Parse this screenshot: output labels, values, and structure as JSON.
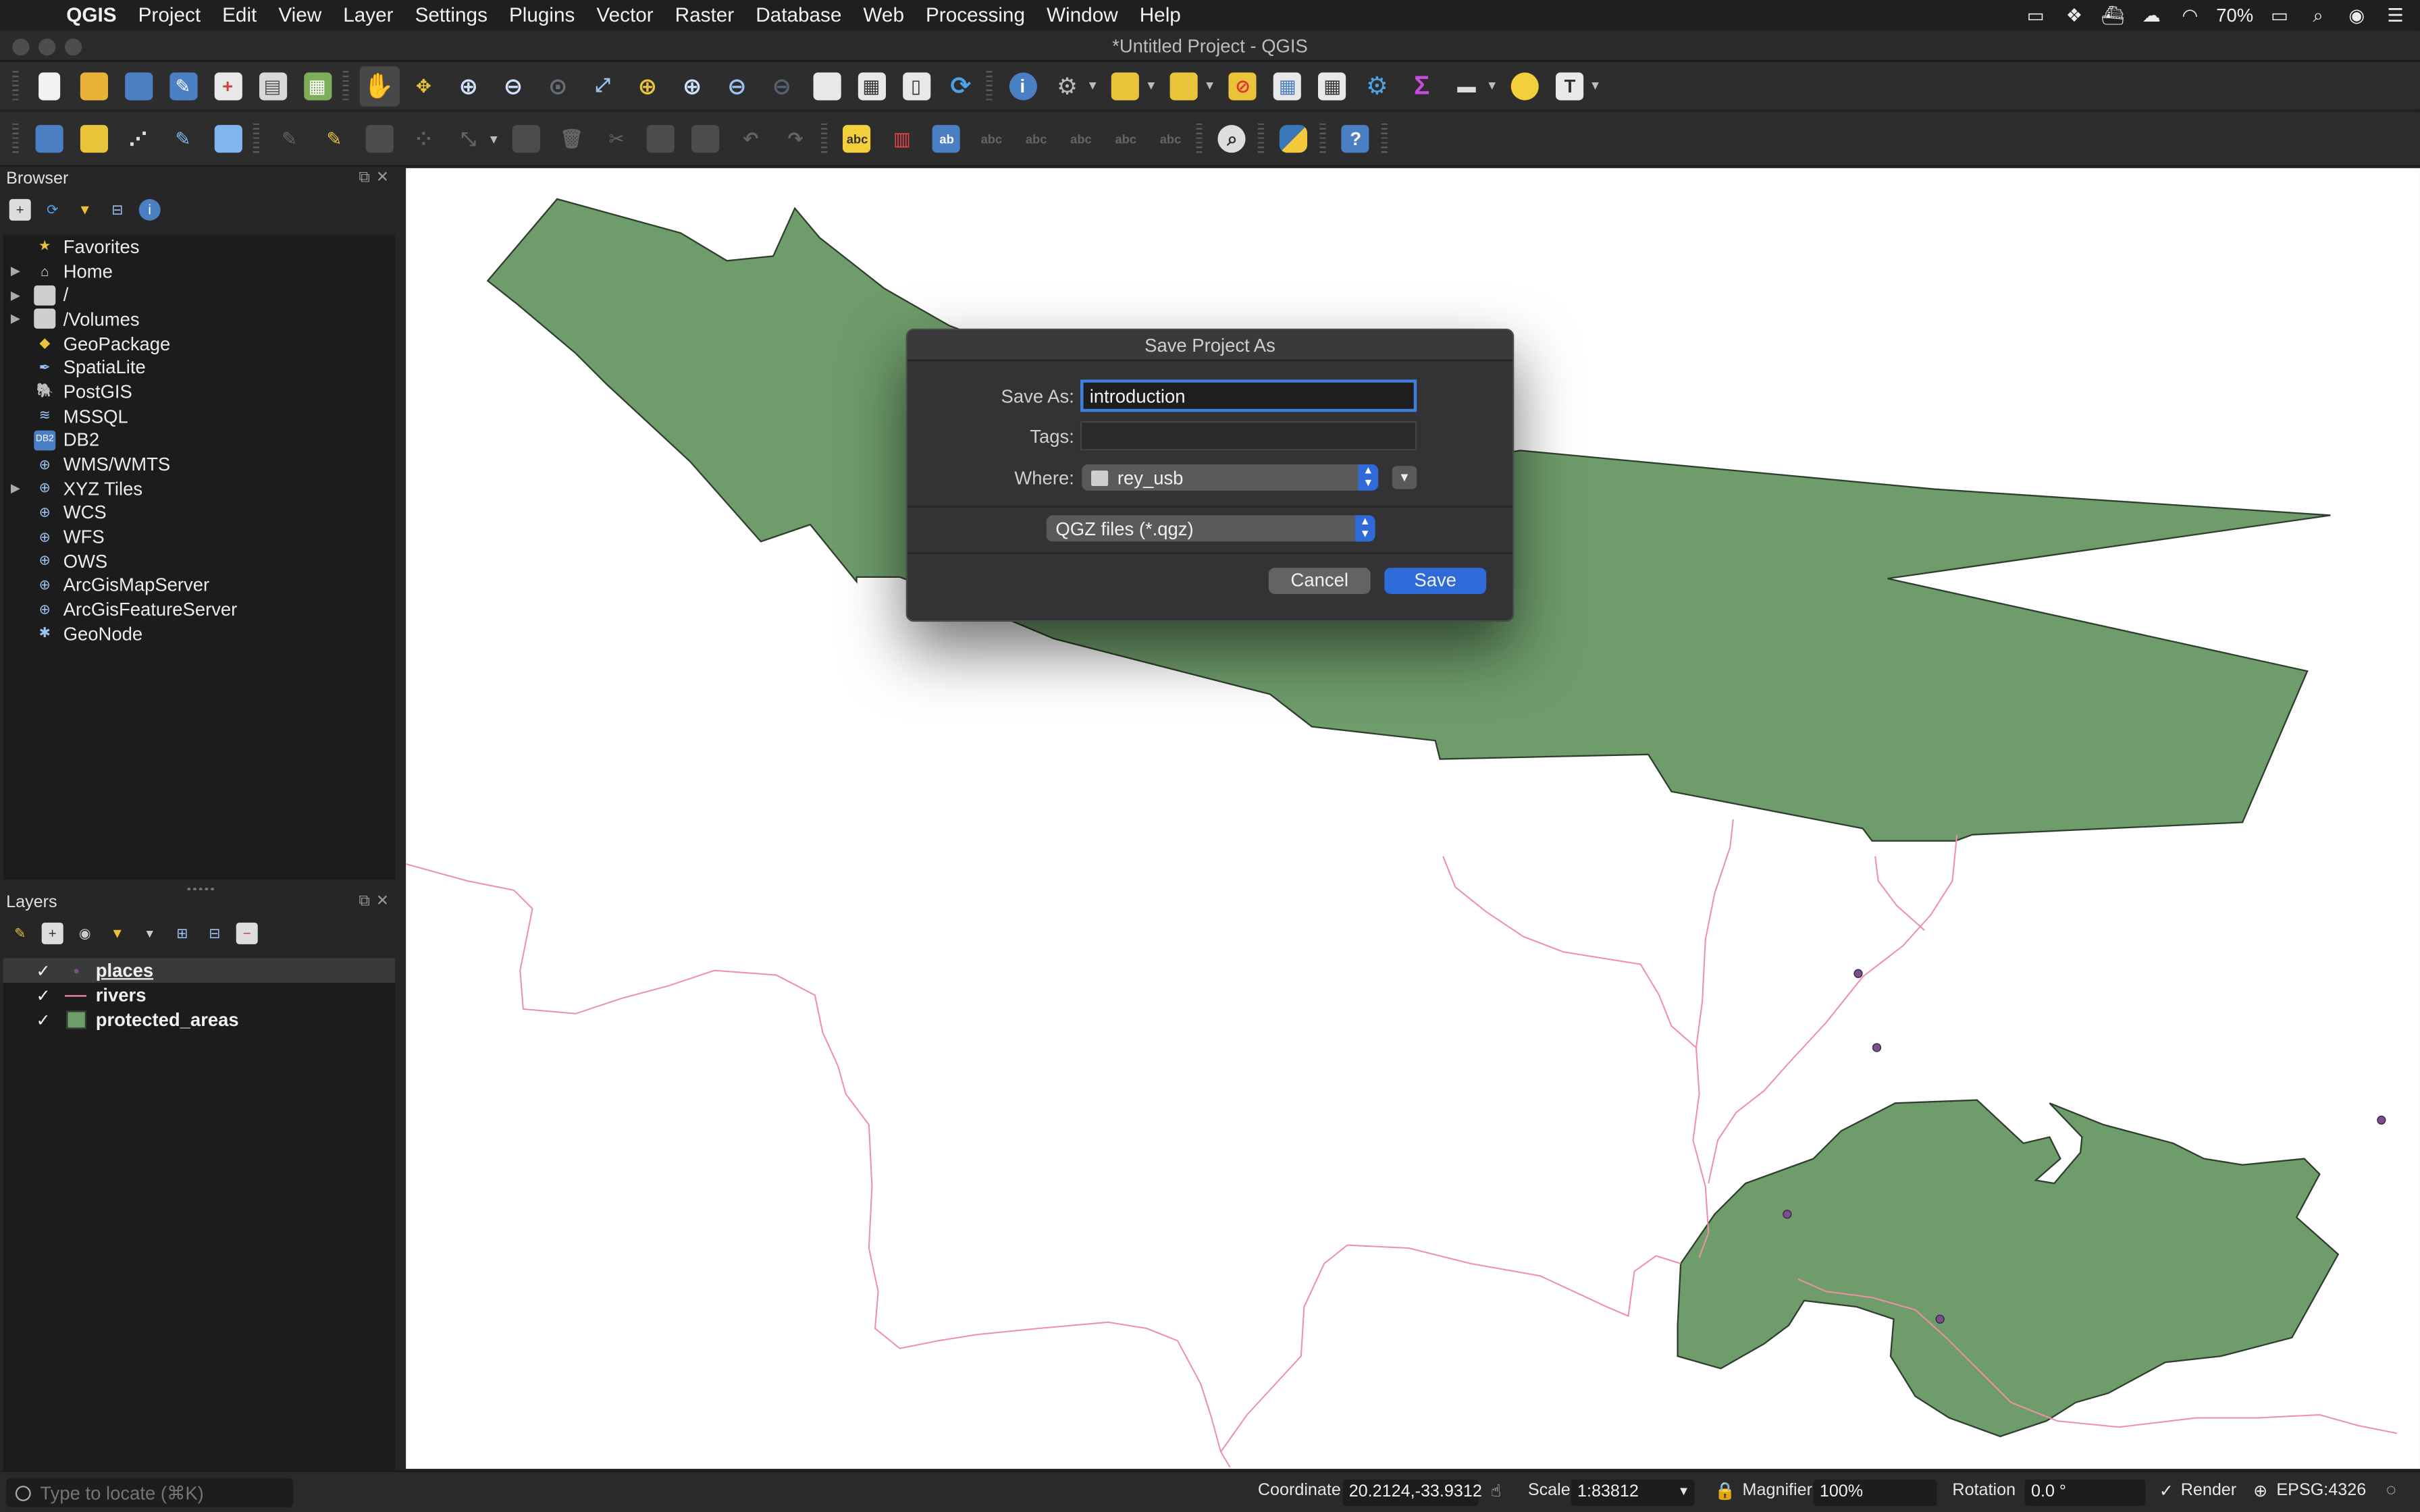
{
  "menubar": {
    "app": "QGIS",
    "items": [
      "Project",
      "Edit",
      "View",
      "Layer",
      "Settings",
      "Plugins",
      "Vector",
      "Raster",
      "Database",
      "Web",
      "Processing",
      "Window",
      "Help"
    ],
    "battery": "70%"
  },
  "window": {
    "title": "*Untitled Project - QGIS"
  },
  "browser": {
    "title": "Browser",
    "items": [
      {
        "label": "Favorites",
        "icon": "star-icon",
        "expandable": false
      },
      {
        "label": "Home",
        "icon": "home-icon",
        "expandable": true
      },
      {
        "label": "/",
        "icon": "folder-icon",
        "expandable": true
      },
      {
        "label": "/Volumes",
        "icon": "folder-icon",
        "expandable": true
      },
      {
        "label": "GeoPackage",
        "icon": "geopackage-icon",
        "expandable": false
      },
      {
        "label": "SpatiaLite",
        "icon": "spatialite-icon",
        "expandable": false
      },
      {
        "label": "PostGIS",
        "icon": "postgis-icon",
        "expandable": false
      },
      {
        "label": "MSSQL",
        "icon": "mssql-icon",
        "expandable": false
      },
      {
        "label": "DB2",
        "icon": "db2-icon",
        "expandable": false
      },
      {
        "label": "WMS/WMTS",
        "icon": "globe-icon",
        "expandable": false
      },
      {
        "label": "XYZ Tiles",
        "icon": "globe-icon",
        "expandable": true
      },
      {
        "label": "WCS",
        "icon": "globe-icon",
        "expandable": false
      },
      {
        "label": "WFS",
        "icon": "globe-icon",
        "expandable": false
      },
      {
        "label": "OWS",
        "icon": "globe-icon",
        "expandable": false
      },
      {
        "label": "ArcGisMapServer",
        "icon": "arcgis-icon",
        "expandable": false
      },
      {
        "label": "ArcGisFeatureServer",
        "icon": "arcgis-icon",
        "expandable": false
      },
      {
        "label": "GeoNode",
        "icon": "geonode-icon",
        "expandable": false
      }
    ]
  },
  "layers": {
    "title": "Layers",
    "items": [
      {
        "label": "places",
        "checked": true,
        "symbol": "point",
        "selected": true
      },
      {
        "label": "rivers",
        "checked": true,
        "symbol": "line",
        "selected": false
      },
      {
        "label": "protected_areas",
        "checked": true,
        "symbol": "polygon",
        "selected": false
      }
    ]
  },
  "dialog": {
    "title": "Save Project As",
    "save_as_label": "Save As:",
    "save_as_value": "introduction",
    "tags_label": "Tags:",
    "tags_value": "",
    "where_label": "Where:",
    "where_value": "rey_usb",
    "format_value": "QGZ files (*.qgz)",
    "cancel_label": "Cancel",
    "save_label": "Save"
  },
  "statusbar": {
    "locator_placeholder": "Type to locate (⌘K)",
    "coordinate_label": "Coordinate",
    "coordinate_value": "20.2124,-33.9312",
    "scale_label": "Scale",
    "scale_value": "1:83812",
    "magnifier_label": "Magnifier",
    "magnifier_value": "100%",
    "rotation_label": "Rotation",
    "rotation_value": "0.0 °",
    "render_label": "Render",
    "crs_value": "EPSG:4326"
  },
  "colors": {
    "polygon_fill": "#6e9c6b",
    "river_stroke": "#f08fa8",
    "point_fill": "#7a4f8a",
    "accent": "#2f6ad9"
  }
}
